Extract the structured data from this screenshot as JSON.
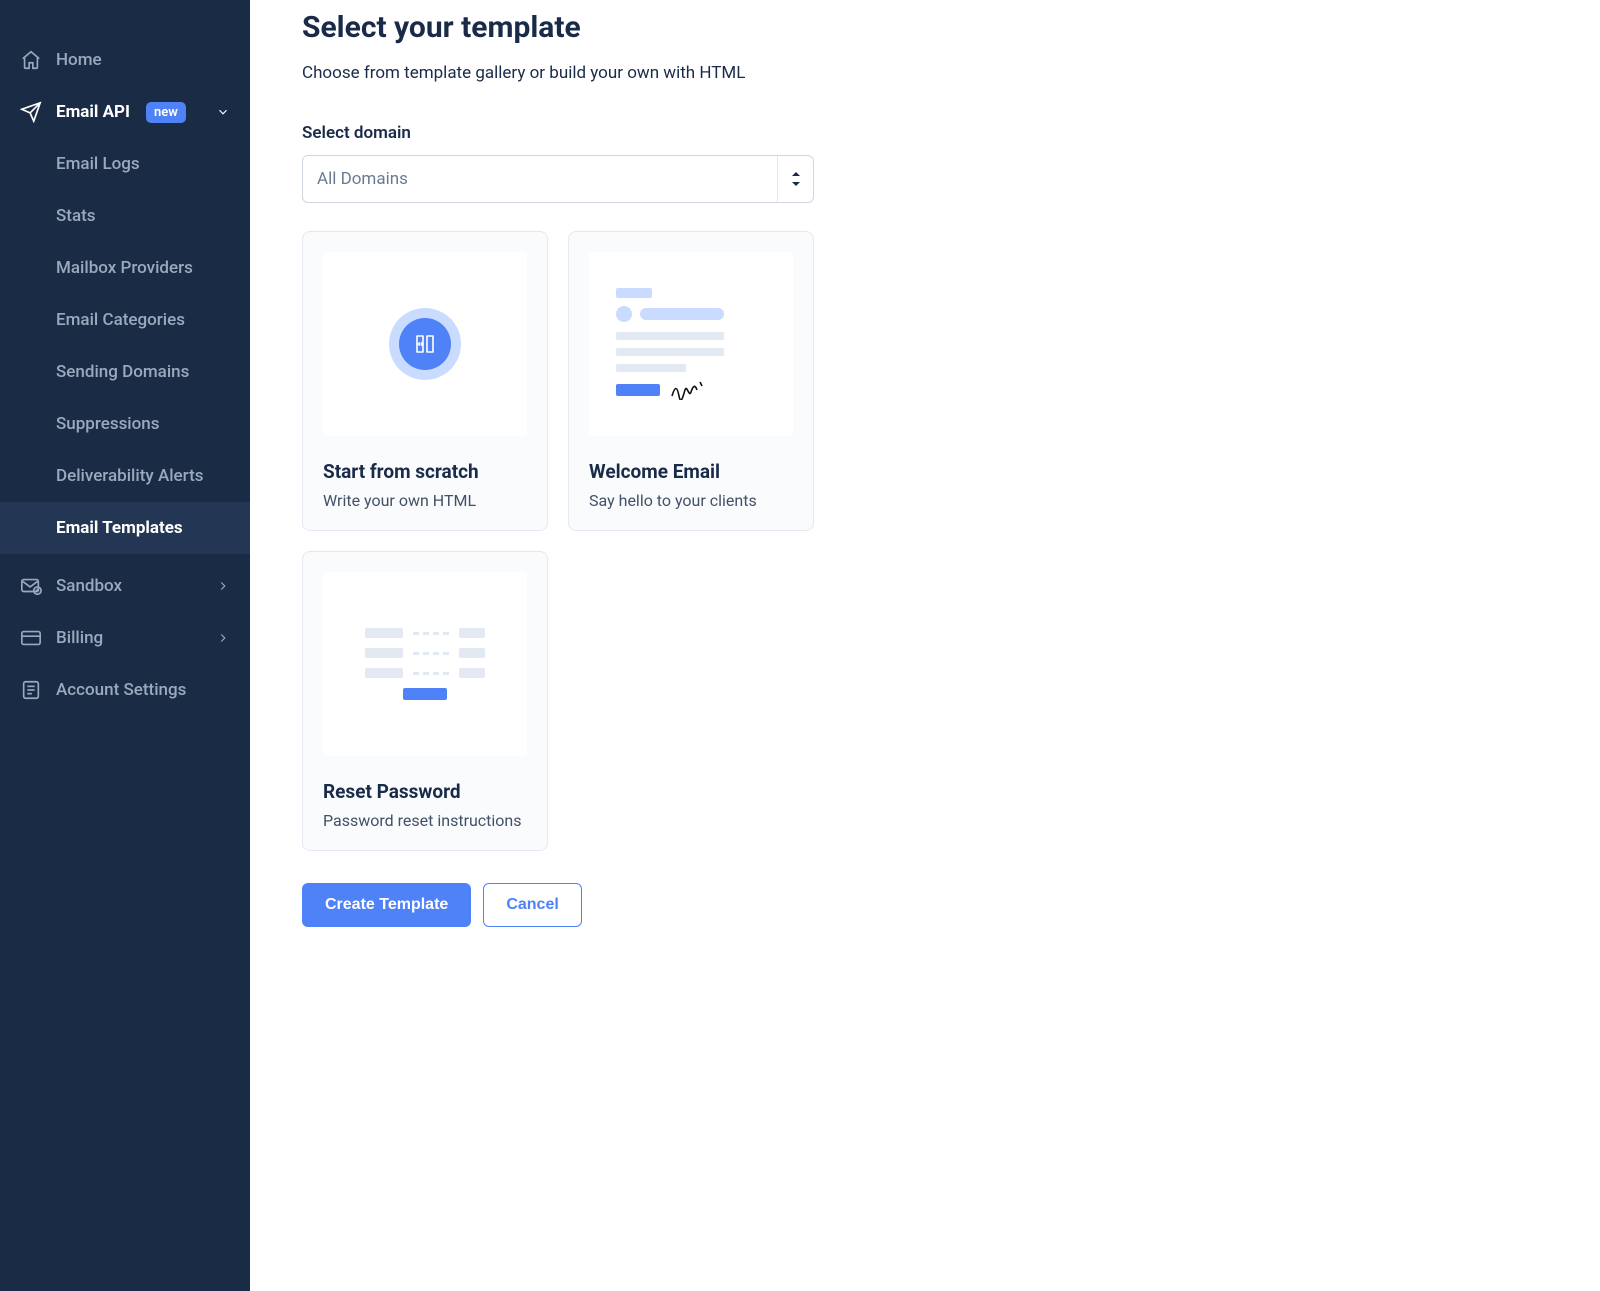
{
  "sidebar": {
    "home": "Home",
    "email_api": {
      "label": "Email API",
      "badge": "new"
    },
    "sub": {
      "email_logs": "Email Logs",
      "stats": "Stats",
      "mailbox_providers": "Mailbox Providers",
      "email_categories": "Email Categories",
      "sending_domains": "Sending Domains",
      "suppressions": "Suppressions",
      "deliverability_alerts": "Deliverability Alerts",
      "email_templates": "Email Templates"
    },
    "sandbox": "Sandbox",
    "billing": "Billing",
    "account_settings": "Account Settings"
  },
  "main": {
    "title": "Select your template",
    "subtitle": "Choose from template gallery or build your own with HTML",
    "domain_label": "Select domain",
    "domain_selected": "All Domains",
    "templates": {
      "scratch": {
        "title": "Start from scratch",
        "desc": "Write your own HTML"
      },
      "welcome": {
        "title": "Welcome Email",
        "desc": "Say hello to your clients"
      },
      "reset": {
        "title": "Reset Password",
        "desc": "Password reset instructions"
      }
    },
    "actions": {
      "create": "Create Template",
      "cancel": "Cancel"
    }
  }
}
